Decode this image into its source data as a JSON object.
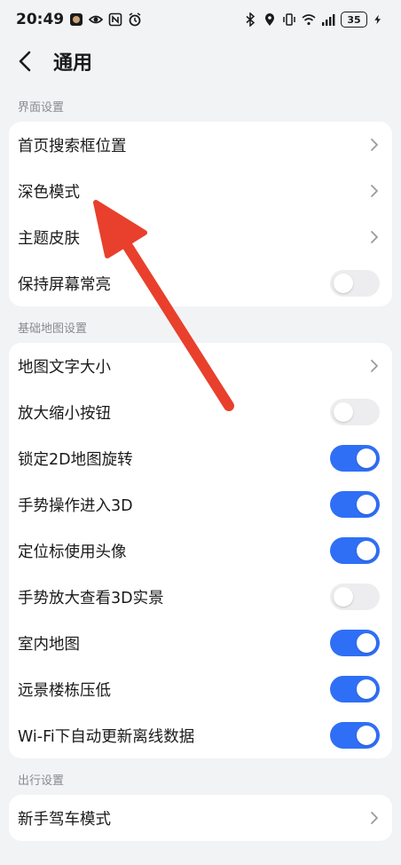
{
  "status_bar": {
    "time": "20:49",
    "battery": "35",
    "left_icons": [
      "avatar-badge-icon",
      "eye-icon",
      "nfc-icon",
      "alarm-icon"
    ],
    "right_icons": [
      "bluetooth-icon",
      "location-icon",
      "vibrate-icon",
      "wifi-icon",
      "signal-icon",
      "charging-icon"
    ]
  },
  "header": {
    "title": "通用"
  },
  "sections": [
    {
      "label": "界面设置",
      "rows": [
        {
          "label": "首页搜索框位置",
          "type": "chevron"
        },
        {
          "label": "深色模式",
          "type": "chevron"
        },
        {
          "label": "主题皮肤",
          "type": "chevron"
        },
        {
          "label": "保持屏幕常亮",
          "type": "toggle",
          "on": false
        }
      ]
    },
    {
      "label": "基础地图设置",
      "rows": [
        {
          "label": "地图文字大小",
          "type": "chevron"
        },
        {
          "label": "放大缩小按钮",
          "type": "toggle",
          "on": false
        },
        {
          "label": "锁定2D地图旋转",
          "type": "toggle",
          "on": true
        },
        {
          "label": "手势操作进入3D",
          "type": "toggle",
          "on": true
        },
        {
          "label": "定位标使用头像",
          "type": "toggle",
          "on": true
        },
        {
          "label": "手势放大查看3D实景",
          "type": "toggle",
          "on": false
        },
        {
          "label": "室内地图",
          "type": "toggle",
          "on": true
        },
        {
          "label": "远景楼栋压低",
          "type": "toggle",
          "on": true
        },
        {
          "label": "Wi-Fi下自动更新离线数据",
          "type": "toggle",
          "on": true
        }
      ]
    },
    {
      "label": "出行设置",
      "rows": [
        {
          "label": "新手驾车模式",
          "type": "chevron"
        }
      ]
    }
  ],
  "colors": {
    "accent": "#2f6ff6",
    "arrow": "#e8402c",
    "background": "#f2f3f5"
  }
}
